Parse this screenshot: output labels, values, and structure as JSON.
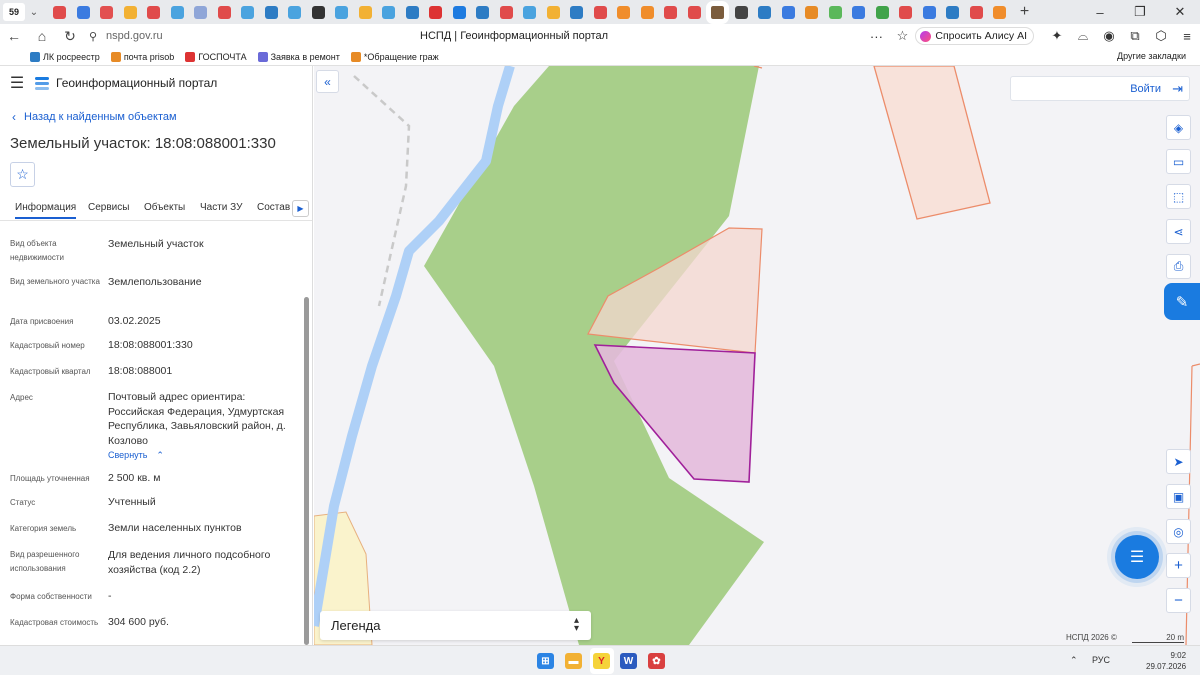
{
  "browser": {
    "tab_count": "59",
    "tab_chevron": "⌄",
    "tab_favicon_colors": [
      "#e04b4b",
      "#3b7be0",
      "#e25050",
      "#f2b134",
      "#e04b4b",
      "#4aa3df",
      "#8fa6d8",
      "#e04b4b",
      "#4aa3df",
      "#2d7cc4",
      "#4aa3df",
      "#333333",
      "#4aa3df",
      "#f2b134",
      "#4aa3df",
      "#2d7cc4",
      "#d33",
      "#1e7be0",
      "#2d7cc4",
      "#e04b4b",
      "#4aa3df",
      "#f2b134",
      "#2d7cc4",
      "#e04b4b",
      "#f08d2b",
      "#f08d2b",
      "#e04b4b",
      "#e04b4b",
      "#7b5c3c",
      "#444444",
      "#2d7cc4",
      "#3b7be0",
      "#e78b26",
      "#5bb85b",
      "#3b7be0",
      "#40a34a",
      "#e04b4b",
      "#3b7be0",
      "#2d7cc4",
      "#e04b4b",
      "#f08d2b"
    ],
    "new_tab_icon": "+",
    "window_controls": [
      "–",
      "❐",
      "✕"
    ],
    "nav": {
      "back": "←",
      "home": "⌂",
      "reload": "↻",
      "lock": "⚲"
    },
    "url": "nspd.gov.ru",
    "page_title": "НСПД | Геоинформационный портал",
    "more_menu": "···",
    "bookmark_star": "☆",
    "alice_button": "Спросить Алису AI",
    "extensions": [
      "✦",
      "⌓",
      "◉",
      "⧉",
      "⬡",
      "≡"
    ],
    "bookmarks": [
      {
        "label": "ЛК росреестр",
        "color": "#2d7cc4"
      },
      {
        "label": "почта prisob",
        "color": "#e78b26"
      },
      {
        "label": "ГОСПОЧТА",
        "color": "#d33"
      },
      {
        "label": "Заявка в ремонт",
        "color": "#6a6ad8"
      },
      {
        "label": "*Обращение граж",
        "color": "#e78b26"
      }
    ],
    "bookmarks_other": "Другие закладки"
  },
  "sidebar": {
    "menu_icon": "☰",
    "portal_name": "Геоинформационный портал",
    "back_chevron": "‹",
    "back_link": "Назад к найденным объектам",
    "parcel_title": "Земельный участок: 18:08:088001:330",
    "favorite_icon": "☆",
    "tabs": [
      "Информация",
      "Сервисы",
      "Объекты",
      "Части ЗУ",
      "Состав"
    ],
    "tabs_next": "▶",
    "fields": [
      {
        "label": "Вид объекта недвижимости",
        "value": "Земельный участок"
      },
      {
        "label": "Вид земельного участка",
        "value": "Землепользование"
      },
      {
        "label": "Дата присвоения",
        "value": "03.02.2025"
      },
      {
        "label": "Кадастровый номер",
        "value": "18:08:088001:330"
      },
      {
        "label": "Кадастровый квартал",
        "value": "18:08:088001"
      },
      {
        "label": "Адрес",
        "value": "Почтовый адрес ориентира: Российская Федерация, Удмуртская Республика, Завьяловский район, д. Козлово"
      },
      {
        "label": "Площадь уточненная",
        "value": "2 500 кв. м"
      },
      {
        "label": "Статус",
        "value": "Учтенный"
      },
      {
        "label": "Категория земель",
        "value": "Земли населенных пунктов"
      },
      {
        "label": "Вид разрешенного использования",
        "value": "Для ведения личного подсобного хозяйства (код 2.2)"
      },
      {
        "label": "Форма собственности",
        "value": "-"
      },
      {
        "label": "Кадастровая стоимость",
        "value": "304 600 руб."
      }
    ],
    "collapse_link": "Свернуть",
    "collapse_caret": "⌃"
  },
  "map": {
    "collapse_sidebar_icon": "«",
    "login_label": "Войти",
    "login_icon": "⇥",
    "tools": [
      {
        "name": "layers-icon",
        "glyph": "◈"
      },
      {
        "name": "ruler-icon",
        "glyph": "▭"
      },
      {
        "name": "select-area-icon",
        "glyph": "⬚"
      },
      {
        "name": "share-icon",
        "glyph": "⋖"
      },
      {
        "name": "print-icon",
        "glyph": "⎙"
      },
      {
        "name": "navigate-icon",
        "glyph": "➤"
      },
      {
        "name": "layout-icon",
        "glyph": "▣"
      },
      {
        "name": "locate-icon",
        "glyph": "◎"
      },
      {
        "name": "zoom-in-icon",
        "glyph": "+"
      },
      {
        "name": "zoom-out-icon",
        "glyph": "−"
      }
    ],
    "ai_tab_icon": "✎",
    "chat_icon": "☰",
    "legend_label": "Легенда",
    "legend_caret_up": "▴",
    "legend_caret_down": "▾",
    "copyright": "НСПД 2026 ©",
    "scale_label": "20 m",
    "colors": {
      "background": "#f3f3f6",
      "forest": "#a8cf8a",
      "river": "#aed0f7",
      "selected_fill": "#e4b9dc",
      "selected_stroke": "#a0209a",
      "parcel_fill": "#f8e2da",
      "parcel_stroke": "#ec8c6a",
      "field_yellow": "#faf3cc"
    }
  },
  "taskbar": {
    "apps": [
      {
        "name": "start-icon",
        "color": "#2b84e4",
        "glyph": "⊞"
      },
      {
        "name": "explorer-icon",
        "color": "#f2b134",
        "glyph": "▬"
      },
      {
        "name": "yandex-browser-icon",
        "color": "#f5d33a",
        "glyph": "Y"
      },
      {
        "name": "word-icon",
        "color": "#2b5bbf",
        "glyph": "W"
      },
      {
        "name": "app-icon",
        "color": "#d94040",
        "glyph": "✿"
      }
    ],
    "tray_chevron": "⌃",
    "language": "РУС",
    "time": "9:02",
    "date": "29.07.2026"
  }
}
